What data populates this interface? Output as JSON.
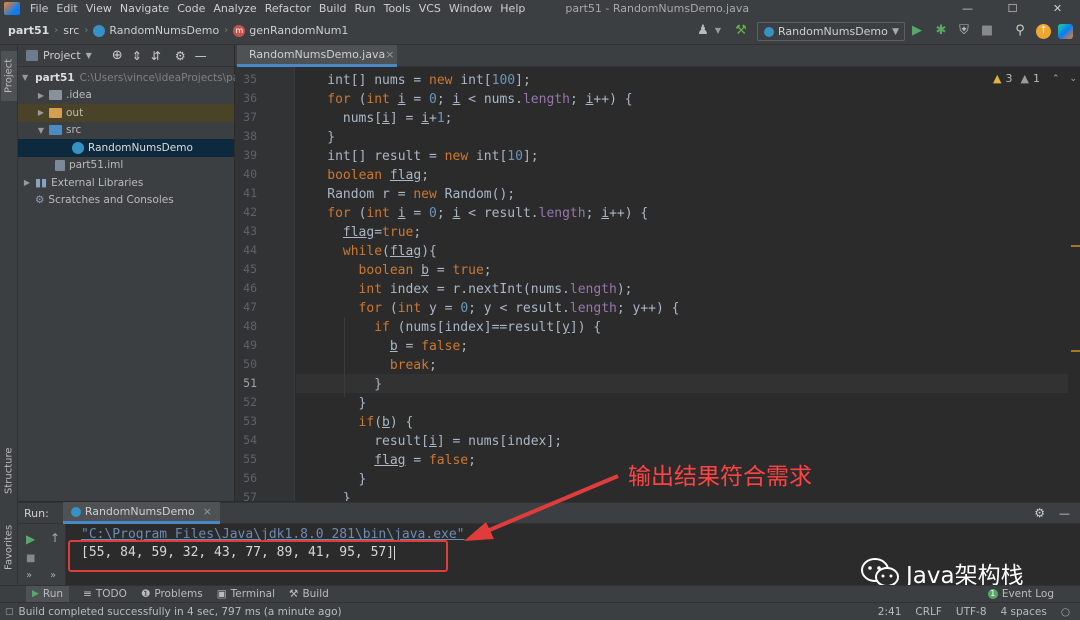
{
  "menu": {
    "items": [
      "File",
      "Edit",
      "View",
      "Navigate",
      "Code",
      "Analyze",
      "Refactor",
      "Build",
      "Run",
      "Tools",
      "VCS",
      "Window",
      "Help"
    ],
    "window_title": "part51 - RandomNumsDemo.java"
  },
  "nav": {
    "crumbs": [
      "part51",
      "src",
      "RandomNumsDemo",
      "genRandomNum1"
    ],
    "run_config": "RandomNumsDemo"
  },
  "side_tabs": {
    "project": "Project",
    "structure": "Structure",
    "favorites": "Favorites"
  },
  "project": {
    "header": "Project",
    "root_name": "part51",
    "root_path": "C:\\Users\\vince\\IdeaProjects\\pa",
    "items": [
      ".idea",
      "out",
      "src",
      "RandomNumsDemo",
      "part51.iml",
      "External Libraries",
      "Scratches and Consoles"
    ]
  },
  "editor": {
    "tab": "RandomNumsDemo.java",
    "warnings": "3",
    "weak_warnings": "1",
    "line_numbers": [
      "35",
      "36",
      "37",
      "38",
      "39",
      "40",
      "41",
      "42",
      "43",
      "44",
      "45",
      "46",
      "47",
      "48",
      "49",
      "50",
      "51",
      "52",
      "53",
      "54",
      "55",
      "56",
      "57"
    ],
    "current_line": "51"
  },
  "run": {
    "label": "Run:",
    "tab": "RandomNumsDemo",
    "command": "\"C:\\Program Files\\Java\\jdk1.8.0_281\\bin\\java.exe\"",
    "output": "[55, 84, 59, 32, 43, 77, 89, 41, 95, 57]"
  },
  "annotation": "输出结果符合需求",
  "toolwindows": [
    "Run",
    "TODO",
    "Problems",
    "Terminal",
    "Build"
  ],
  "event_log": "Event Log",
  "status": {
    "message": "Build completed successfully in 4 sec, 797 ms (a minute ago)",
    "position": "2:41",
    "line_sep": "CRLF",
    "encoding": "UTF-8",
    "indent": "4 spaces"
  },
  "watermark": "Java架构栈"
}
